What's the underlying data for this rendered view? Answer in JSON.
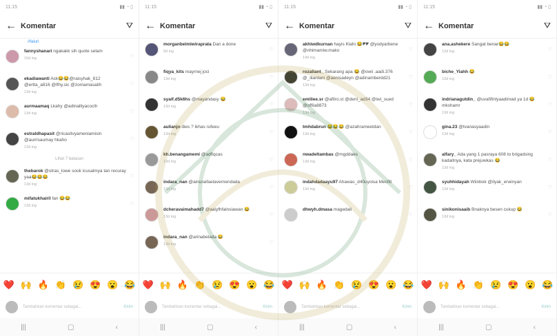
{
  "panels": [
    {
      "status_time": "11:15",
      "header_title": "Komentar",
      "top_fragment": "#faluri",
      "comments": [
        {
          "user": "fannyshanari",
          "text": "ngakakk sih quote selam",
          "meta": "10d ing",
          "color": "#c9a"
        },
        {
          "user": "ekadiawanti",
          "text": "Ack😂😂@raisyhak_812 @ertta_a816 @lfhy.sic @zomamasalih",
          "meta": "13d ing",
          "color": "#555"
        },
        {
          "user": "aurmaamaq",
          "text": "Lkahy @adinalliyacocih",
          "meta": "13d ing",
          "color": "#dba"
        },
        {
          "user": "estraldhapasit",
          "text": "@ricasitvyameniamisin @aurrisaumay hkaho",
          "meta": "13d ing",
          "color": "#444"
        },
        {
          "user": "thebarok",
          "text": "@otras_lowe sook icusalmya tan recuray yaa😂😂😂",
          "meta": "13d ing",
          "color": "#665"
        },
        {
          "user": "mifatukhairil",
          "text": "fan 😂😂",
          "meta": "13d ing",
          "color": "#3a4"
        }
      ],
      "more_label": "Lihat 7 balasan",
      "input_placeholder": "Tambahkan komentar sebagai...",
      "input_action": "Kirim"
    },
    {
      "status_time": "11:15",
      "header_title": "Komentar",
      "top_fragment": "",
      "comments": [
        {
          "user": "morganbelmiwiraprata",
          "text": "Dan a done",
          "meta": "5d ing",
          "color": "#557"
        },
        {
          "user": "fiqya_kits",
          "text": "mayrnej joci",
          "meta": "13d ing",
          "color": "#888"
        },
        {
          "user": "syaif.d5k6hs",
          "text": "@mayandasy 😂",
          "meta": "13d ing",
          "color": "#333"
        },
        {
          "user": "aulianjo",
          "text": "dies ? ikhas rufeeu",
          "meta": "13d ing",
          "color": "#653"
        },
        {
          "user": "kh.benangamemi",
          "text": "@adfiqcas",
          "meta": "13d ing",
          "color": "#999"
        },
        {
          "user": "indara_nan",
          "text": "@ainuraifaelavernendada",
          "meta": "13d ing",
          "color": "#765"
        },
        {
          "user": "dcheravaimahadd7",
          "text": "@aaiyfhfainsiawan 😂",
          "meta": "13d ing",
          "color": "#c99"
        },
        {
          "user": "indara_nan",
          "text": "@arinabelada 😂",
          "meta": "13d ing",
          "color": "#765"
        }
      ],
      "more_label": "",
      "input_placeholder": "Tambahkan komentar sebagai...",
      "input_action": "Kirim"
    },
    {
      "status_time": "11:15",
      "header_title": "Komentar",
      "top_fragment": "",
      "comments": [
        {
          "user": "akhiwdkurnan",
          "text": "hayis Klahi 😂🎔🎔 @yodyarbene @nhimamiw.mako",
          "meta": "14d ing",
          "color": "#667"
        },
        {
          "user": "rozaliant_",
          "text": "Sekarang apa 😂 @owii .aadi.376 @_ilianlam @aenisadeyn @adinamberdd21",
          "meta": "13d ing",
          "color": "#443"
        },
        {
          "user": "emiliee.sr",
          "text": "@afilro.st @deni_ad34 @iwi_sued @offila8873",
          "meta": "13d ing",
          "color": "#dbb"
        },
        {
          "user": "tmhdabrun",
          "text": "😂😂😂 @azahrameetdan",
          "meta": "13d ing",
          "color": "#111"
        },
        {
          "user": "nwadeltambas",
          "text": "@mgddaes",
          "meta": "13d ing",
          "color": "#c65"
        },
        {
          "user": "indahdadaayu97",
          "text": "Ahawas_d40uyoisa Mecfill",
          "meta": "13d ing",
          "color": "#cc9"
        },
        {
          "user": "dhwyh.dmasa",
          "text": "magedali",
          "meta": "",
          "color": "#ccc"
        }
      ],
      "more_label": "",
      "input_placeholder": "Tambahkan komentar sebagai...",
      "input_action": "Kirim"
    },
    {
      "status_time": "11:15",
      "header_title": "Komentar",
      "top_fragment": "",
      "comments": [
        {
          "user": "ana.ashekere",
          "text": "Sangat benar😂😂",
          "meta": "13d ing",
          "color": "#444"
        },
        {
          "user": "biche_Yiahh",
          "text": "😂",
          "meta": "13d ing",
          "color": "#5a5"
        },
        {
          "user": "indrianagutdin_",
          "text": "@uvafifinlyaadimad ya 1d 😂 mkshamr",
          "meta": "13d ing",
          "color": "#333"
        },
        {
          "user": "gina.23",
          "text": "@tvanasyaadin",
          "meta": "13d ing",
          "color": "#fff"
        },
        {
          "user": "alfary_",
          "text": "Ada yang 1 pasraya 608 to brigadsing kadaitnya, kata prejuwkas 😂",
          "meta": "13d ing",
          "color": "#665"
        },
        {
          "user": "syuhhidayah",
          "text": "Wiinbok @ilyak_erwinyan",
          "meta": "13d ing",
          "color": "#454"
        },
        {
          "user": "sinikonisaaib",
          "text": "Bnaknya besen cukup 😂",
          "meta": "13d ing",
          "color": "#554"
        }
      ],
      "more_label": "",
      "input_placeholder": "Tambahkan komentar sebagai...",
      "input_action": "Kirim"
    }
  ],
  "emoji_bar": [
    "❤️",
    "🙌",
    "🔥",
    "👏",
    "😢",
    "😍",
    "😮",
    "😂"
  ],
  "nav_icons": [
    "recent-apps-icon",
    "home-icon",
    "back-icon"
  ],
  "accent": "#3897f0"
}
